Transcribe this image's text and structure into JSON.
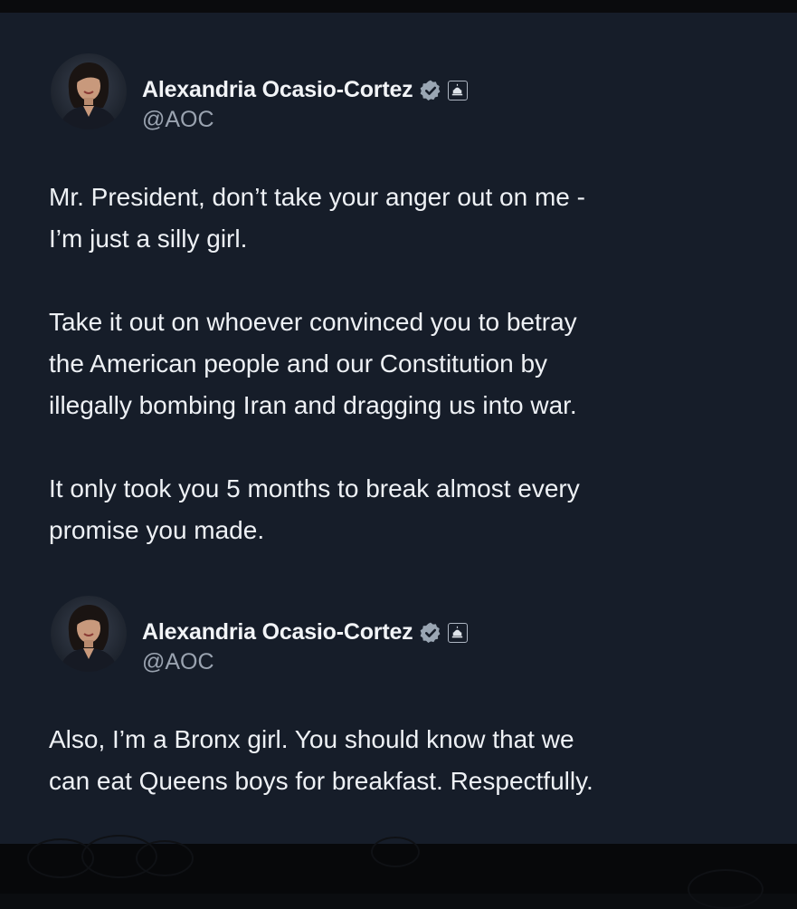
{
  "tweets": [
    {
      "display_name": "Alexandria Ocasio-Cortez",
      "handle": "@AOC",
      "verified_icon": "verified-badge-icon",
      "affiliate_icon": "capitol-building-icon",
      "paragraphs": [
        "Mr. President, don’t take your anger out on me -\nI’m just a silly girl.",
        "Take it out on whoever convinced you to betray\nthe American people and our Constitution by\nillegally bombing Iran and dragging us into war.",
        "It only took you 5 months to break almost every\npromise you made."
      ]
    },
    {
      "display_name": "Alexandria Ocasio-Cortez",
      "handle": "@AOC",
      "verified_icon": "verified-badge-icon",
      "affiliate_icon": "capitol-building-icon",
      "paragraphs": [
        "Also, I’m a Bronx girl. You should know that we\ncan eat Queens boys for breakfast. Respectfully."
      ]
    }
  ],
  "colors": {
    "background": "#161d29",
    "name": "#f2f4f7",
    "handle": "#9aa3b0",
    "text": "#eef1f5",
    "verified_badge": "#9aa6b3"
  }
}
